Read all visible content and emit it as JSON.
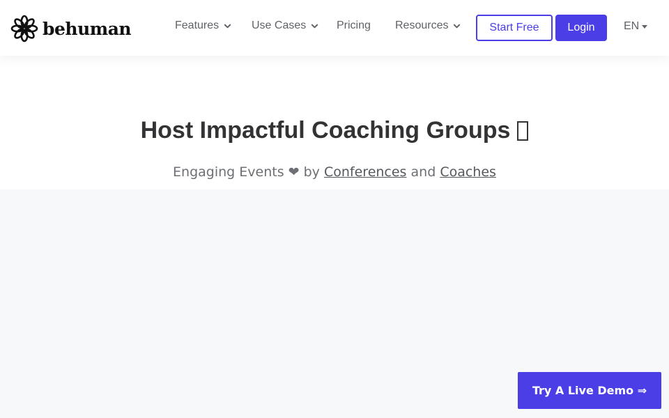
{
  "brand": {
    "name": "behuman",
    "accent_color": "#4b3ee6"
  },
  "nav": {
    "features": "Features",
    "use_cases": "Use Cases",
    "pricing": "Pricing",
    "resources": "Resources",
    "start_free": "Start Free",
    "login": "Login",
    "language": "EN"
  },
  "hero": {
    "title": "Host Impactful Coaching Groups",
    "subtitle_prefix": "Engaging Events",
    "heart": "❤",
    "by": "by",
    "link_conferences": "Conferences",
    "and": "and",
    "link_coaches": "Coaches"
  },
  "cta": {
    "demo_label": "Try A Live Demo ⇒"
  }
}
